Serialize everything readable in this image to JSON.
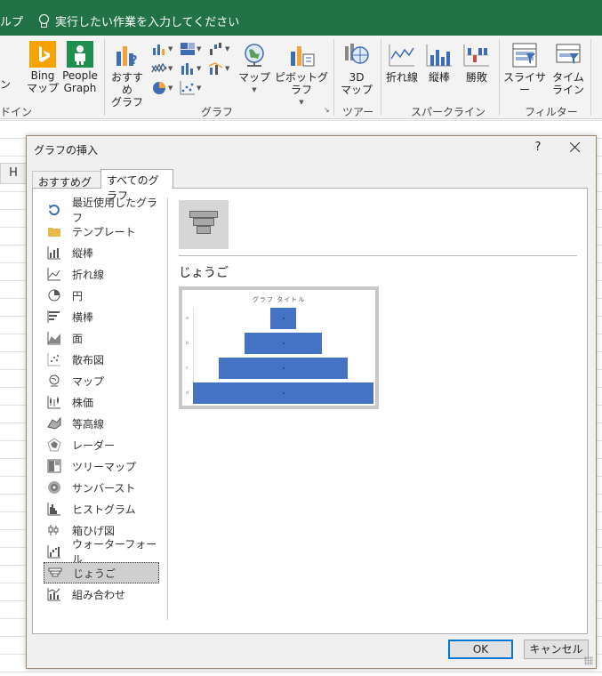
{
  "topbar": {
    "help_tab": "ルプ",
    "tell_me": "実行したい作業を入力してください"
  },
  "ribbon": {
    "addins_fragment": "ン",
    "addins_group": "ドイン",
    "bing_map": [
      "Bing",
      "マップ"
    ],
    "people_graph": [
      "People",
      "Graph"
    ],
    "recommended_charts": [
      "おすすめ",
      "グラフ"
    ],
    "map": "マップ",
    "pivot_chart": "ピボットグラフ",
    "charts_group": "グラフ",
    "map3d": [
      "3D",
      "マップ"
    ],
    "tours_group": "ツアー",
    "sparkline_line": "折れ線",
    "sparkline_column": "縦棒",
    "sparkline_winloss": "勝敗",
    "sparklines_group": "スパークライン",
    "slicer": "スライサー",
    "timeline": [
      "タイム",
      "ライン"
    ],
    "filters_group": "フィルター",
    "colors": {
      "bing": "#f7a200",
      "people": "#1f8f4f",
      "accent": "#217346"
    }
  },
  "sheet": {
    "column_h": "H"
  },
  "dialog": {
    "title": "グラフの挿入",
    "help": "?",
    "tabs": [
      "おすすめグラフ",
      "すべてのグラフ"
    ],
    "chart_types": [
      {
        "label": "最近使用したグラフ",
        "icon": "recent-icon"
      },
      {
        "label": "テンプレート",
        "icon": "folder-icon"
      },
      {
        "label": "縦棒",
        "icon": "column-chart-icon"
      },
      {
        "label": "折れ線",
        "icon": "line-chart-icon"
      },
      {
        "label": "円",
        "icon": "pie-chart-icon"
      },
      {
        "label": "横棒",
        "icon": "bar-chart-icon"
      },
      {
        "label": "面",
        "icon": "area-chart-icon"
      },
      {
        "label": "散布図",
        "icon": "scatter-chart-icon"
      },
      {
        "label": "マップ",
        "icon": "map-chart-icon"
      },
      {
        "label": "株価",
        "icon": "stock-chart-icon"
      },
      {
        "label": "等高線",
        "icon": "surface-chart-icon"
      },
      {
        "label": "レーダー",
        "icon": "radar-chart-icon"
      },
      {
        "label": "ツリーマップ",
        "icon": "treemap-chart-icon"
      },
      {
        "label": "サンバースト",
        "icon": "sunburst-chart-icon"
      },
      {
        "label": "ヒストグラム",
        "icon": "histogram-chart-icon"
      },
      {
        "label": "箱ひげ図",
        "icon": "boxwhisker-chart-icon"
      },
      {
        "label": "ウォーターフォール",
        "icon": "waterfall-chart-icon"
      },
      {
        "label": "じょうご",
        "icon": "funnel-chart-icon"
      },
      {
        "label": "組み合わせ",
        "icon": "combo-chart-icon"
      }
    ],
    "selected_index": 17,
    "preview_heading": "じょうご",
    "preview_chart_title": "グラフ タイトル",
    "ok": "OK",
    "cancel": "キャンセル"
  },
  "chart_data": {
    "type": "bar",
    "title": "グラフ タイトル",
    "categories": [
      "a",
      "b",
      "c",
      "d"
    ],
    "values": [
      1,
      3,
      5,
      7
    ],
    "bar_color": "#4472c4"
  }
}
